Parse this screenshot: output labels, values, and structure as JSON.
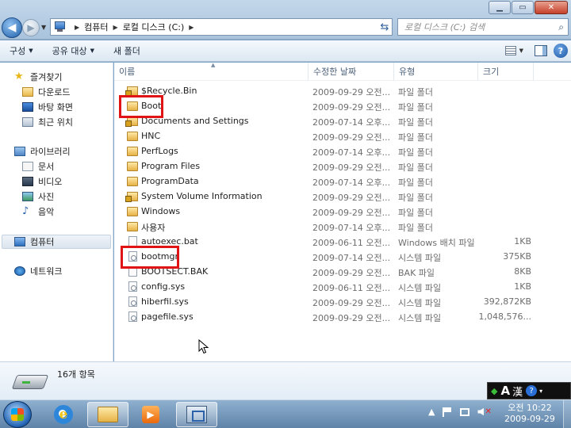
{
  "window": {
    "minimize_label": "▁",
    "maximize_label": "▭",
    "close_label": "✕"
  },
  "address": {
    "crumbs": [
      "컴퓨터",
      "로컬 디스크 (C:)"
    ],
    "search_placeholder": "로컬 디스크 (C:) 검색"
  },
  "toolbar": {
    "organize": "구성",
    "share": "공유 대상",
    "new_folder": "새 폴더"
  },
  "nav": {
    "favorites": "즐겨찾기",
    "downloads": "다운로드",
    "desktop": "바탕 화면",
    "recent": "최근 위치",
    "libraries": "라이브러리",
    "documents": "문서",
    "videos": "비디오",
    "pictures": "사진",
    "music": "음악",
    "computer": "컴퓨터",
    "network": "네트워크"
  },
  "columns": {
    "name": "이름",
    "date": "수정한 날짜",
    "type": "유형",
    "size": "크기"
  },
  "files": [
    {
      "name": "$Recycle.Bin",
      "date": "2009-09-29 오전...",
      "type": "파일 폴더",
      "size": "",
      "icon": "lock-folder-icon"
    },
    {
      "name": "Boot",
      "date": "2009-09-29 오전...",
      "type": "파일 폴더",
      "size": "",
      "icon": "folder-icon"
    },
    {
      "name": "Documents and Settings",
      "date": "2009-07-14 오후...",
      "type": "파일 폴더",
      "size": "",
      "icon": "lock-folder-icon"
    },
    {
      "name": "HNC",
      "date": "2009-09-29 오전...",
      "type": "파일 폴더",
      "size": "",
      "icon": "folder-icon"
    },
    {
      "name": "PerfLogs",
      "date": "2009-07-14 오후...",
      "type": "파일 폴더",
      "size": "",
      "icon": "folder-icon"
    },
    {
      "name": "Program Files",
      "date": "2009-09-29 오전...",
      "type": "파일 폴더",
      "size": "",
      "icon": "folder-icon"
    },
    {
      "name": "ProgramData",
      "date": "2009-07-14 오후...",
      "type": "파일 폴더",
      "size": "",
      "icon": "folder-icon"
    },
    {
      "name": "System Volume Information",
      "date": "2009-09-29 오전...",
      "type": "파일 폴더",
      "size": "",
      "icon": "lock-folder-icon"
    },
    {
      "name": "Windows",
      "date": "2009-09-29 오전...",
      "type": "파일 폴더",
      "size": "",
      "icon": "folder-icon"
    },
    {
      "name": "사용자",
      "date": "2009-07-14 오후...",
      "type": "파일 폴더",
      "size": "",
      "icon": "folder-icon"
    },
    {
      "name": "autoexec.bat",
      "date": "2009-06-11 오전...",
      "type": "Windows 배치 파일",
      "size": "1KB",
      "icon": "batch-file-icon"
    },
    {
      "name": "bootmgr",
      "date": "2009-07-14 오전...",
      "type": "시스템 파일",
      "size": "375KB",
      "icon": "system-file-icon"
    },
    {
      "name": "BOOTSECT.BAK",
      "date": "2009-09-29 오전...",
      "type": "BAK 파일",
      "size": "8KB",
      "icon": "file-icon"
    },
    {
      "name": "config.sys",
      "date": "2009-06-11 오전...",
      "type": "시스템 파일",
      "size": "1KB",
      "icon": "system-file-icon"
    },
    {
      "name": "hiberfil.sys",
      "date": "2009-09-29 오전...",
      "type": "시스템 파일",
      "size": "392,872KB",
      "icon": "system-file-icon"
    },
    {
      "name": "pagefile.sys",
      "date": "2009-09-29 오전...",
      "type": "시스템 파일",
      "size": "1,048,576...",
      "icon": "system-file-icon"
    }
  ],
  "details": {
    "item_count": "16개 항목"
  },
  "ime": {
    "mode": "A",
    "hanja": "漢",
    "help": "?"
  },
  "taskbar": {
    "clock_time": "오전 10:22",
    "clock_date": "2009-09-29"
  },
  "colors": {
    "highlight_box": "#e01414",
    "taskbar": "#5f83a8",
    "title_bar": "#a9c3dd"
  }
}
